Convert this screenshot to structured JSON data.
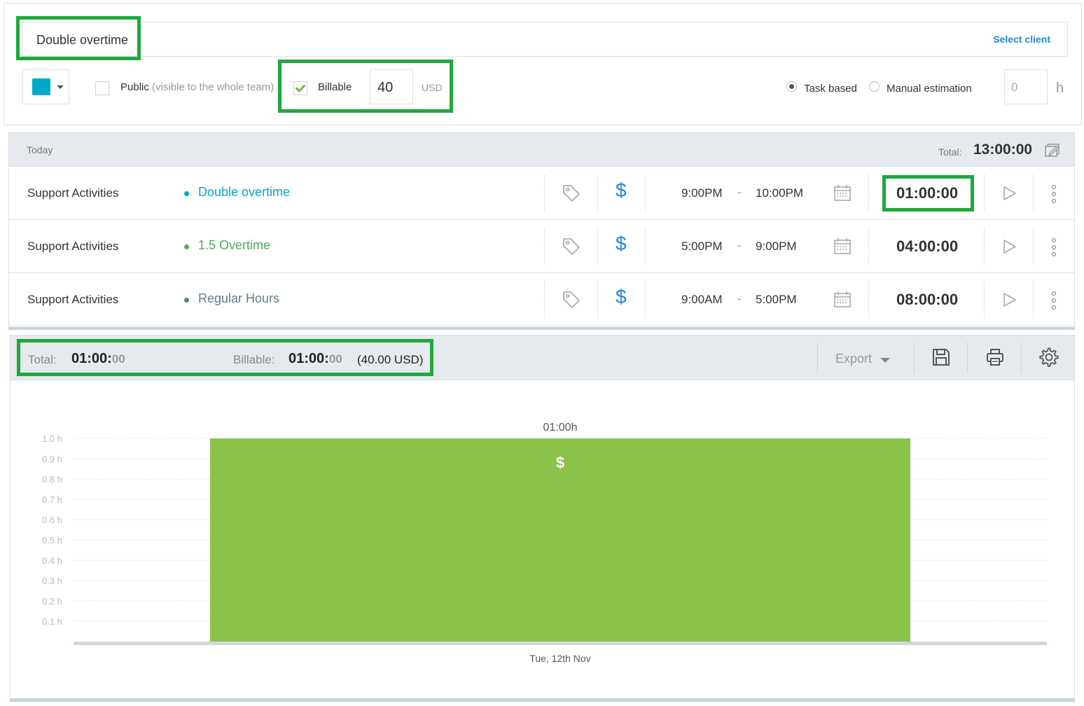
{
  "project": {
    "name": "Double overtime",
    "select_client": "Select client",
    "color": "#03a9c9",
    "public_label": "Public",
    "public_sub": "(visible to the whole team)",
    "public_checked": false,
    "billable_label": "Billable",
    "billable_checked": true,
    "rate": "40",
    "currency": "USD",
    "estimation": {
      "task_based_label": "Task based",
      "manual_label": "Manual estimation",
      "selected": "task_based",
      "value": "0",
      "unit": "h"
    }
  },
  "today": {
    "label": "Today",
    "total_label": "Total:",
    "total_value": "13:00:00",
    "entries": [
      {
        "description": "Support Activities",
        "project": "Double overtime",
        "project_color": "#03a9c9",
        "start": "9:00PM",
        "dash": "-",
        "end": "10:00PM",
        "duration": "01:00:00"
      },
      {
        "description": "Support Activities",
        "project": "1.5 Overtime",
        "project_color": "#4caf50",
        "start": "5:00PM",
        "dash": "-",
        "end": "9:00PM",
        "duration": "04:00:00"
      },
      {
        "description": "Support Activities",
        "project": "Regular Hours",
        "project_color": "#607d8b",
        "start": "9:00AM",
        "dash": "-",
        "end": "5:00PM",
        "duration": "08:00:00"
      }
    ]
  },
  "summary": {
    "total_label": "Total:",
    "total_main": "01:00:",
    "total_sec": "00",
    "billable_label": "Billable:",
    "billable_main": "01:00:",
    "billable_sec": "00",
    "billable_amount": "(40.00 USD)",
    "export_label": "Export"
  },
  "chart_data": {
    "type": "bar",
    "categories": [
      "Tue, 12th Nov"
    ],
    "values": [
      1.0
    ],
    "value_labels": [
      "01:00h"
    ],
    "bar_marker": "$",
    "bar_color": "#8bc34a",
    "yticks": [
      "0.1 h",
      "0.2 h",
      "0.3 h",
      "0.4 h",
      "0.5 h",
      "0.6 h",
      "0.7 h",
      "0.8 h",
      "0.9 h",
      "1.0 h"
    ],
    "ylim": [
      0,
      1.0
    ],
    "grid": true
  }
}
